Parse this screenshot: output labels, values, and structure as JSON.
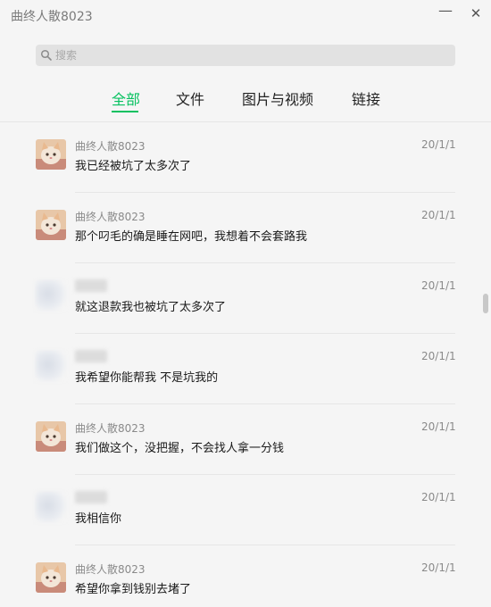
{
  "window": {
    "title": "曲终人散8023",
    "minimize_label": "—",
    "close_label": "✕"
  },
  "search": {
    "placeholder": "搜索",
    "value": ""
  },
  "tabs": [
    {
      "label": "全部",
      "active": true
    },
    {
      "label": "文件",
      "active": false
    },
    {
      "label": "图片与视频",
      "active": false
    },
    {
      "label": "链接",
      "active": false
    }
  ],
  "messages": [
    {
      "sender": "曲终人散8023",
      "date": "20/1/1",
      "text": "我已经被坑了太多次了",
      "avatar": "cat-avatar"
    },
    {
      "sender": "曲终人散8023",
      "date": "20/1/1",
      "text": "那个叼毛的确是睡在网吧，我想着不会套路我",
      "avatar": "cat-avatar"
    },
    {
      "sender": "",
      "date": "20/1/1",
      "text": "就这退款我也被坑了太多次了",
      "avatar": "blurred-avatar"
    },
    {
      "sender": "",
      "date": "20/1/1",
      "text": "我希望你能帮我 不是坑我的",
      "avatar": "blurred-avatar"
    },
    {
      "sender": "曲终人散8023",
      "date": "20/1/1",
      "text": "我们做这个，没把握，不会找人拿一分钱",
      "avatar": "cat-avatar"
    },
    {
      "sender": "",
      "date": "20/1/1",
      "text": "我相信你",
      "avatar": "blurred-avatar"
    },
    {
      "sender": "曲终人散8023",
      "date": "20/1/1",
      "text": "希望你拿到钱别去堵了",
      "avatar": "cat-avatar"
    }
  ],
  "colors": {
    "accent": "#07c160",
    "background": "#f5f5f5",
    "muted_text": "#8a8a8a"
  }
}
